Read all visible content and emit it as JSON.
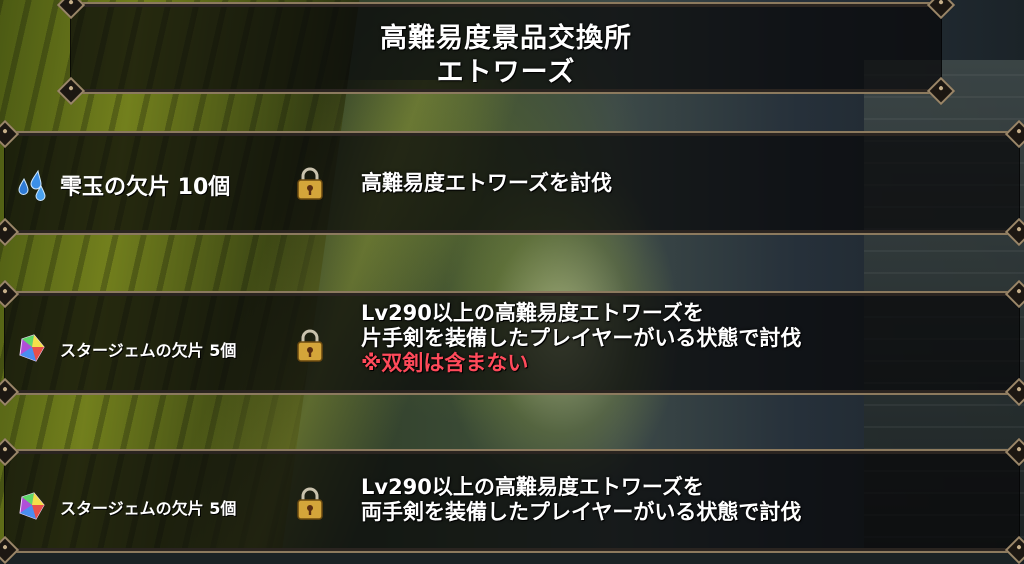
{
  "title": {
    "line1": "高難易度景品交換所",
    "line2": "エトワーズ"
  },
  "rewards": [
    {
      "item_label": "雫玉の欠片 10個",
      "item_icon": "droplet-gems-icon",
      "lock_icon": "padlock-icon",
      "condition_lines": [
        "高難易度エトワーズを討伐"
      ],
      "note": ""
    },
    {
      "item_label": "スタージェムの欠片 5個",
      "item_icon": "star-gem-shard-icon",
      "lock_icon": "padlock-icon",
      "condition_lines": [
        "Lv290以上の高難易度エトワーズを",
        "片手剣を装備したプレイヤーがいる状態で討伐"
      ],
      "note": "※双剣は含まない"
    },
    {
      "item_label": "スタージェムの欠片 5個",
      "item_icon": "star-gem-shard-icon",
      "lock_icon": "padlock-icon",
      "condition_lines": [
        "Lv290以上の高難易度エトワーズを",
        "両手剣を装備したプレイヤーがいる状態で討伐"
      ],
      "note": ""
    }
  ],
  "colors": {
    "frame_border": "#8c7a5e",
    "note_red": "#ff4a5a",
    "lock_gold": "#d4a53a"
  }
}
